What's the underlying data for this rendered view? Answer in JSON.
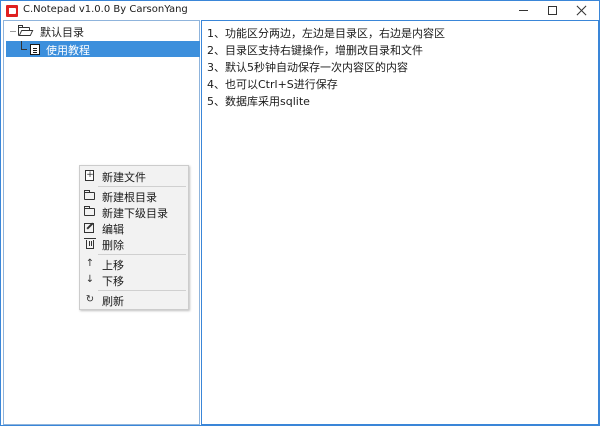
{
  "window": {
    "title": "C.Notepad v1.0.0 By CarsonYang",
    "accent_color": "#3a86d8",
    "app_icon_color": "#e02020",
    "controls": {
      "minimize_icon": "minimize-icon",
      "maximize_icon": "maximize-icon",
      "close_icon": "close-icon"
    }
  },
  "tree": {
    "root": {
      "label": "默认目录",
      "icon": "folder-open-icon"
    },
    "children": [
      {
        "label": "使用教程",
        "icon": "document-icon",
        "selected": true
      }
    ],
    "selection_color": "#3c8fdc"
  },
  "context_menu": {
    "groups": [
      [
        {
          "label": "新建文件",
          "icon": "new-file-icon"
        }
      ],
      [
        {
          "label": "新建根目录",
          "icon": "folder-icon"
        },
        {
          "label": "新建下级目录",
          "icon": "folder-icon"
        },
        {
          "label": "编辑",
          "icon": "edit-icon"
        },
        {
          "label": "删除",
          "icon": "trash-icon"
        }
      ],
      [
        {
          "label": "上移",
          "icon": "arrow-up-icon"
        },
        {
          "label": "下移",
          "icon": "arrow-down-icon"
        }
      ],
      [
        {
          "label": "刷新",
          "icon": "refresh-icon"
        }
      ]
    ]
  },
  "content": {
    "lines": [
      "1、功能区分两边，左边是目录区，右边是内容区",
      "2、目录区支持右键操作，增删改目录和文件",
      "3、默认5秒钟自动保存一次内容区的内容",
      "4、也可以Ctrl+S进行保存",
      "5、数据库采用sqlite"
    ]
  }
}
